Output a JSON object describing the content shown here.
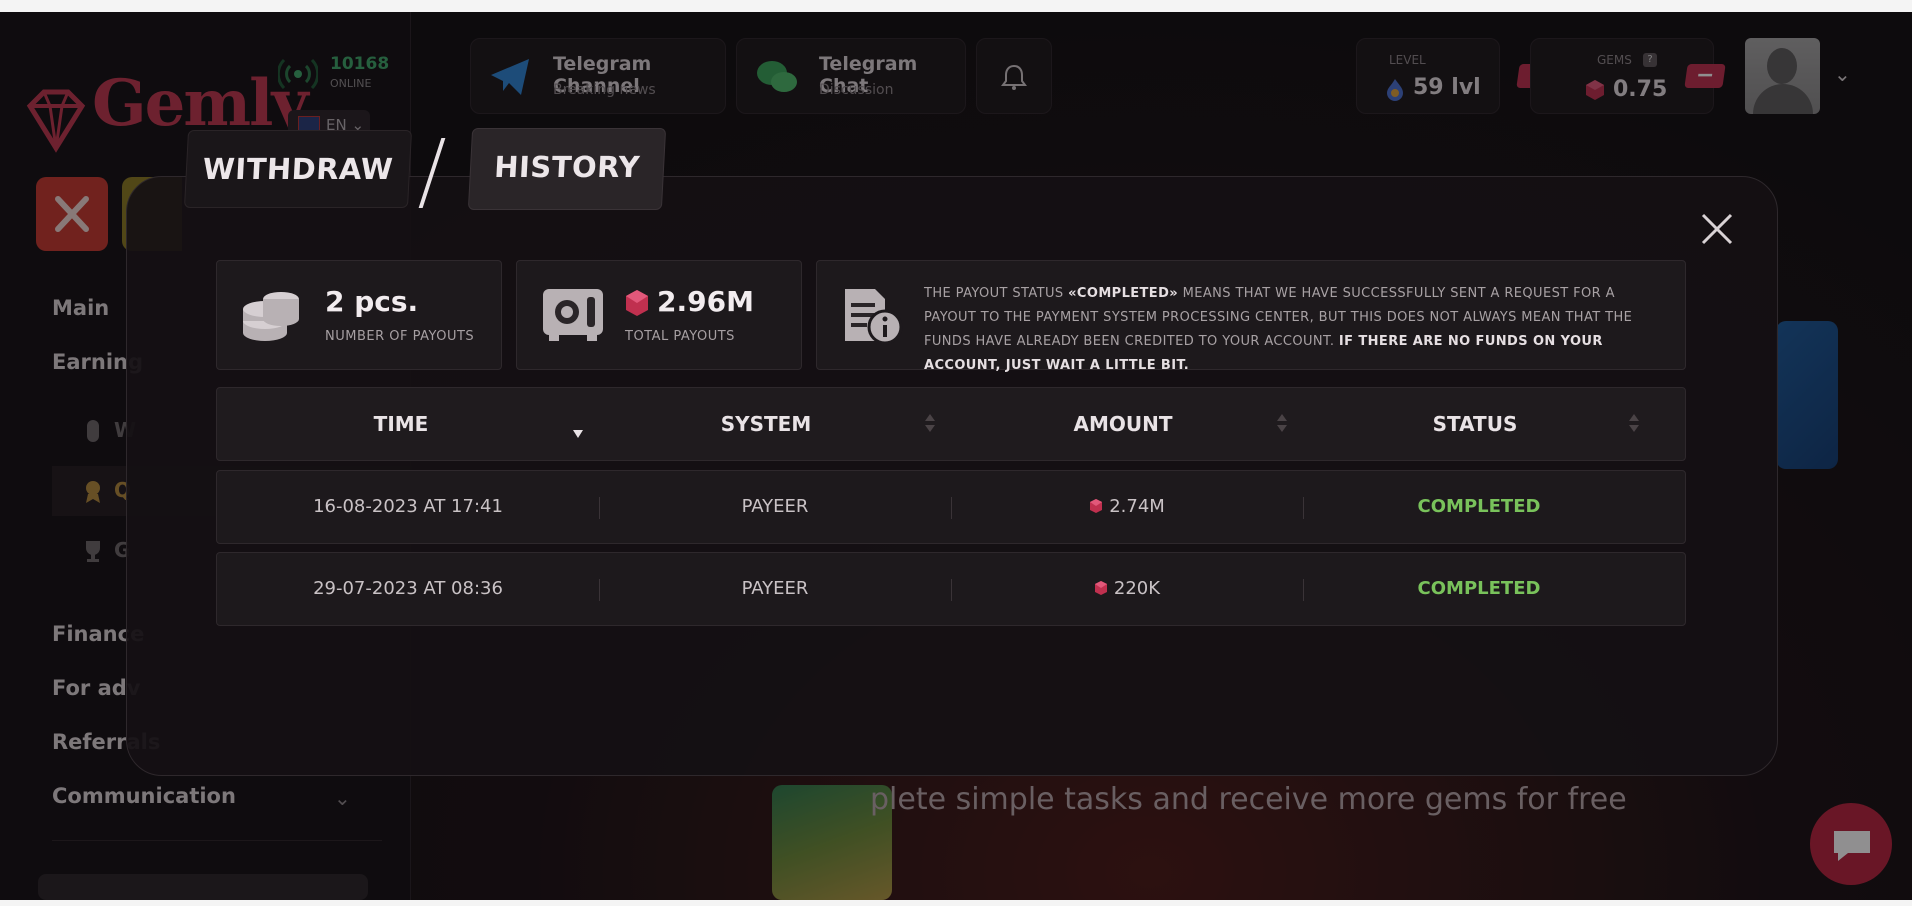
{
  "header": {
    "logo_text": "Gemly",
    "online_count": "10168",
    "online_label": "ONLINE",
    "language": "EN",
    "telegram_channel": {
      "title": "Telegram Channel",
      "subtitle": "Breaking news"
    },
    "telegram_chat": {
      "title": "Telegram Chat",
      "subtitle": "Discussion"
    },
    "level": {
      "label": "LEVEL",
      "value": "59 lvl"
    },
    "gems": {
      "label": "GEMS",
      "value": "0.75",
      "add_label": "+",
      "remove_label": "−"
    }
  },
  "sidebar": {
    "main": "Main",
    "earnings": "Earning",
    "sub_items": [
      "W",
      "Q",
      "G"
    ],
    "finance": "Finance",
    "for_advertisers": "For adv",
    "referrals": "Referrals",
    "communication": "Communication"
  },
  "background": {
    "promo_text": "plete simple tasks and receive more gems for free"
  },
  "modal": {
    "tabs": {
      "withdraw": "WITHDRAW",
      "history": "HISTORY"
    },
    "stats": {
      "payouts_count": "2 pcs.",
      "payouts_count_label": "NUMBER OF PAYOUTS",
      "total_payouts": "2.96M",
      "total_payouts_label": "TOTAL PAYOUTS"
    },
    "info": {
      "part1": "THE PAYOUT STATUS ",
      "status_word": "«COMPLETED»",
      "part2": " MEANS THAT WE HAVE SUCCESSFULLY SENT A REQUEST FOR A PAYOUT TO THE PAYMENT SYSTEM PROCESSING CENTER, BUT THIS DOES NOT ALWAYS MEAN THAT THE FUNDS HAVE ALREADY BEEN CREDITED TO YOUR ACCOUNT. ",
      "emphasis": "IF THERE ARE NO FUNDS ON YOUR ACCOUNT, JUST WAIT A LITTLE BIT."
    },
    "table": {
      "columns": [
        "TIME",
        "SYSTEM",
        "AMOUNT",
        "STATUS"
      ],
      "rows": [
        {
          "time": "16-08-2023 AT 17:41",
          "system": "PAYEER",
          "amount": "2.74M",
          "status": "COMPLETED"
        },
        {
          "time": "29-07-2023 AT 08:36",
          "system": "PAYEER",
          "amount": "220K",
          "status": "COMPLETED"
        }
      ]
    }
  },
  "colors": {
    "accent": "#c0304f",
    "status_completed": "#79c25b",
    "online_green": "#3fa86b",
    "telegram_blue": "#2f86d6",
    "wechat_green": "#3aa55a"
  }
}
